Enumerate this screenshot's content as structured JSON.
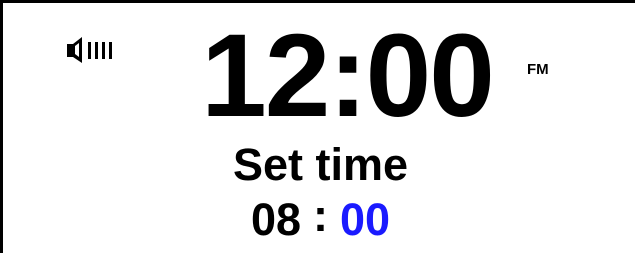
{
  "display": {
    "time": "12:00",
    "band": "FM"
  },
  "volume": {
    "icon": "speaker-volume-icon",
    "level_bars": 4
  },
  "set_time": {
    "title": "Set time",
    "hours": "08",
    "separator": ":",
    "minutes": "00"
  },
  "colors": {
    "background": "#ffffff",
    "text": "#000000",
    "active_field": "#1a1aff"
  }
}
